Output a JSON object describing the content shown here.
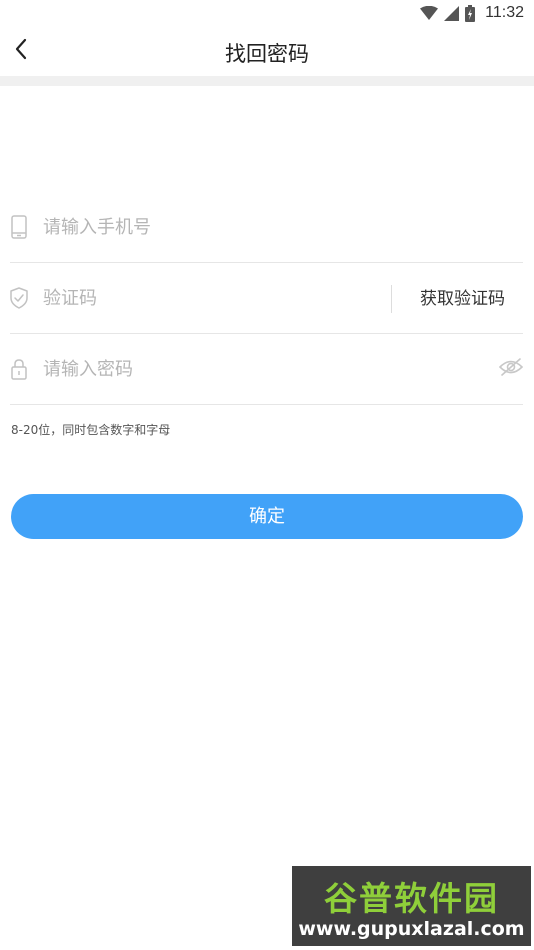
{
  "status_bar": {
    "time": "11:32",
    "icons": [
      "wifi-icon",
      "cell-signal-icon",
      "battery-charging-icon"
    ]
  },
  "nav": {
    "title": "找回密码",
    "back_icon": "chevron-left-icon"
  },
  "form": {
    "phone": {
      "placeholder": "请输入手机号",
      "value": "",
      "icon": "phone-icon"
    },
    "code": {
      "placeholder": "验证码",
      "value": "",
      "icon": "shield-check-icon",
      "get_code_label": "获取验证码"
    },
    "password": {
      "placeholder": "请输入密码",
      "value": "",
      "icon": "lock-icon",
      "toggle_icon": "eye-off-icon"
    },
    "hint": "8-20位，同时包含数字和字母",
    "submit_label": "确定"
  },
  "colors": {
    "primary": "#41a2f8",
    "divider": "#e6e6e6",
    "placeholder": "#b5b5b5",
    "watermark_green": "#8fcf3a"
  },
  "watermark": {
    "title": "谷普软件园",
    "url": "www.gupuxlazal.com"
  }
}
